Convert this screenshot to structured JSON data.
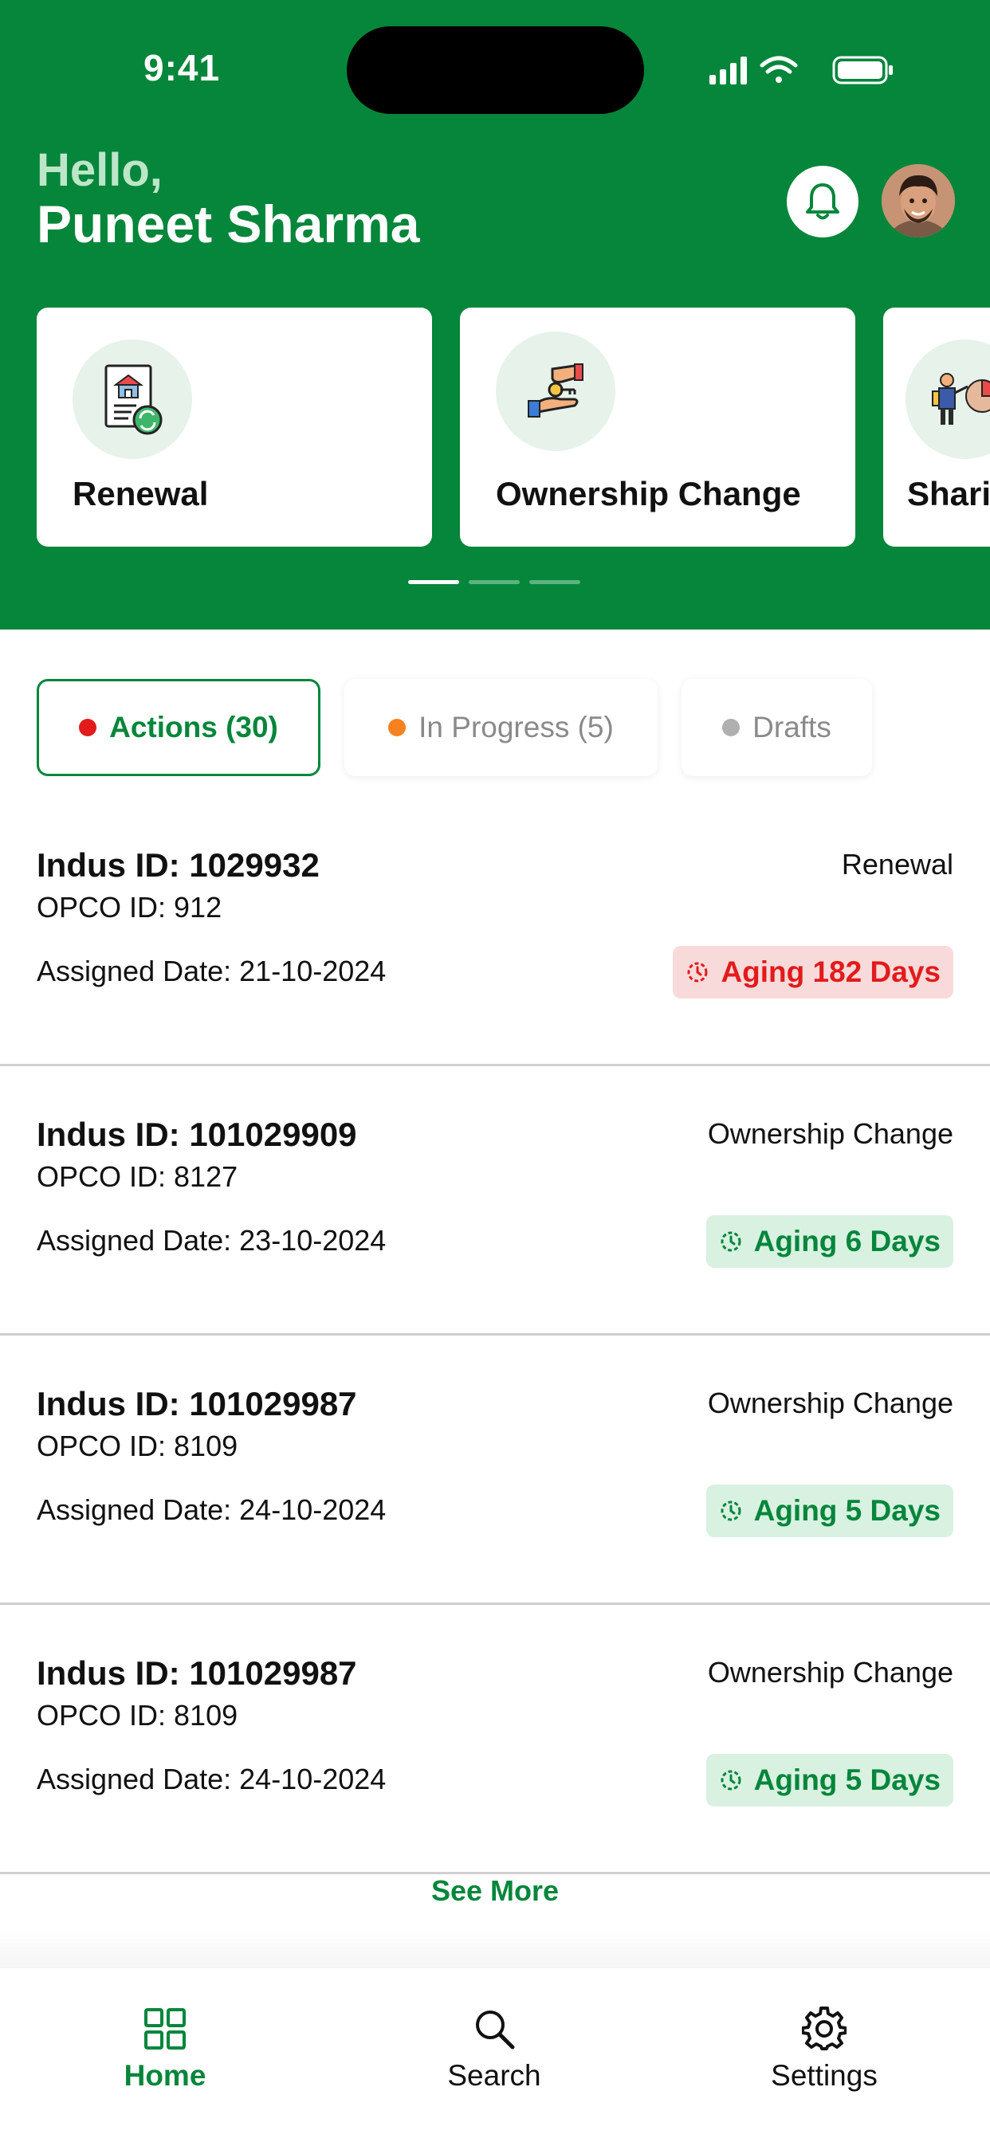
{
  "status_bar": {
    "time": "9:41"
  },
  "header": {
    "greeting": "Hello,",
    "user_name": "Puneet Sharma",
    "bell_icon": "bell-icon",
    "avatar": "user-avatar"
  },
  "services": [
    {
      "label": "Renewal",
      "icon": "building-document-icon"
    },
    {
      "label": "Ownership Change",
      "icon": "hand-key-icon"
    },
    {
      "label": "Shari",
      "icon": "sharing-person-chart-icon"
    }
  ],
  "pager": {
    "pages": 3,
    "active": 0
  },
  "tabs": [
    {
      "label": "Actions (30)",
      "dot_color": "#e21b1b",
      "active": true
    },
    {
      "label": "In Progress (5)",
      "dot_color": "#f5821f",
      "active": false
    },
    {
      "label": "Drafts",
      "dot_color": "#b0b0b0",
      "active": false
    }
  ],
  "items": [
    {
      "indus_id": "Indus ID: 1029932",
      "opco_id": "OPCO ID: 912",
      "assigned": "Assigned Date: 21-10-2024",
      "type": "Renewal",
      "aging": "Aging 182 Days",
      "status": "red"
    },
    {
      "indus_id": "Indus ID: 101029909",
      "opco_id": "OPCO ID: 8127",
      "assigned": "Assigned Date: 23-10-2024",
      "type": "Ownership Change",
      "aging": "Aging 6 Days",
      "status": "green"
    },
    {
      "indus_id": "Indus ID: 101029987",
      "opco_id": "OPCO ID: 8109",
      "assigned": "Assigned Date: 24-10-2024",
      "type": "Ownership Change",
      "aging": "Aging 5 Days",
      "status": "green"
    },
    {
      "indus_id": "Indus ID: 101029987",
      "opco_id": "OPCO ID: 8109",
      "assigned": "Assigned Date: 24-10-2024",
      "type": "Ownership Change",
      "aging": "Aging 5 Days",
      "status": "green"
    }
  ],
  "see_more": "See More",
  "nav": [
    {
      "label": "Home",
      "icon": "grid-icon",
      "active": true
    },
    {
      "label": "Search",
      "icon": "search-icon",
      "active": false
    },
    {
      "label": "Settings",
      "icon": "gear-icon",
      "active": false
    }
  ],
  "colors": {
    "brand_green": "#05863b",
    "alert_red": "#e21b1b"
  }
}
